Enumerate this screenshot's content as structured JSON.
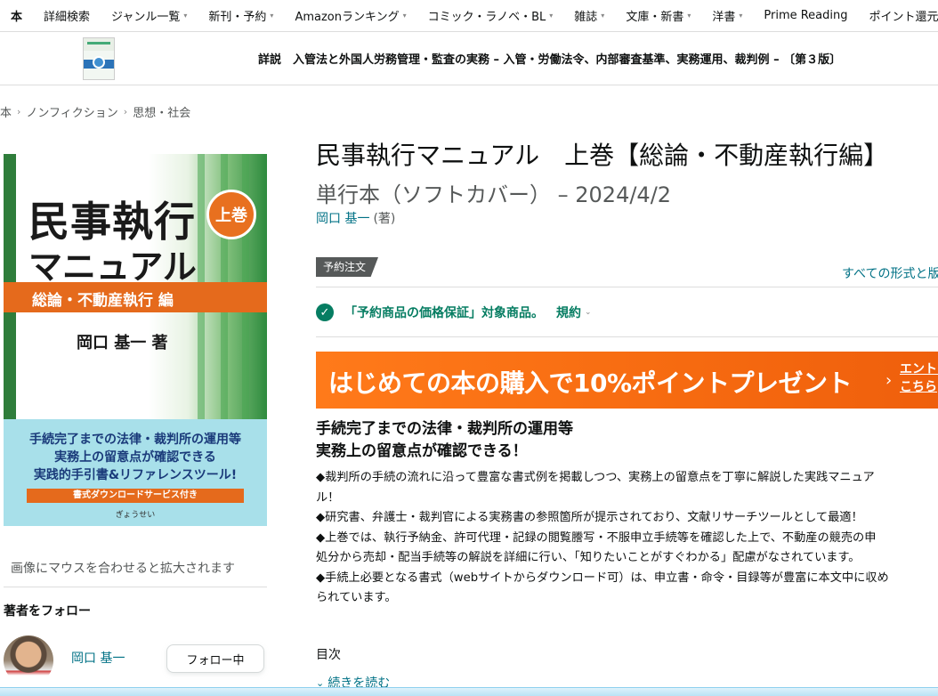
{
  "topnav": {
    "items": [
      {
        "label": "本",
        "caret": false
      },
      {
        "label": "詳細検索",
        "caret": false
      },
      {
        "label": "ジャンル一覧",
        "caret": true
      },
      {
        "label": "新刊・予約",
        "caret": true
      },
      {
        "label": "Amazonランキング",
        "caret": true
      },
      {
        "label": "コミック・ラノベ・BL",
        "caret": true
      },
      {
        "label": "雑誌",
        "caret": true
      },
      {
        "label": "文庫・新書",
        "caret": true
      },
      {
        "label": "洋書",
        "caret": true
      },
      {
        "label": "Prime Reading",
        "caret": false
      },
      {
        "label": "ポイント還元",
        "caret": false
      }
    ]
  },
  "subheader": {
    "title": "詳説　入管法と外国人労務管理・監査の実務 – 入管・労働法令、内部審査基準、実務運用、裁判例 – 〔第３版〕"
  },
  "breadcrumb": [
    "本",
    "ノンフィクション",
    "思想・社会"
  ],
  "cover": {
    "title_line1": "民事執行",
    "title_line2": "マニュアル",
    "volume_badge": "上巻",
    "band": "総論・不動産執行 編",
    "author": "岡口 基一 著",
    "tagline": [
      "手続完了までの法律・裁判所の運用等",
      "実務上の留意点が確認できる",
      "実践的手引書&リファレンスツール!"
    ],
    "download": "書式ダウンロードサービス付き",
    "publisher": "ぎょうせい"
  },
  "left": {
    "zoom_hint": "画像にマウスを合わせると拡大されます",
    "follow_heading": "著者をフォロー",
    "author_name": "岡口 基一",
    "follow_button": "フォロー中"
  },
  "product": {
    "title": "民事執行マニュアル　上巻【総論・不動産執行編】",
    "subtitle": "単行本（ソフトカバー） – 2024/4/2",
    "author": "岡口 基一",
    "role": "(著)",
    "preorder_tag": "予約注文",
    "all_formats": "すべての形式と版",
    "guarantee_text": "「予約商品の価格保証」対象商品。",
    "terms_label": "規約"
  },
  "promo": {
    "text": "はじめての本の購入で10%ポイントプレゼント",
    "entry_line1": "エントリー",
    "entry_line2": "こちら"
  },
  "description": {
    "heading_line1": "手続完了までの法律・裁判所の運用等",
    "heading_line2": "実務上の留意点が確認できる！",
    "lines": [
      "◆裁判所の手続の流れに沿って豊富な書式例を掲載しつつ、実務上の留意点を丁寧に解説した実践マニュア",
      "ル！",
      "◆研究書、弁護士・裁判官による実務書の参照箇所が提示されており、文献リサーチツールとして最適！",
      "◆上巻では、執行予納金、許可代理・記録の閲覧謄写・不服申立手続等を確認した上で、不動産の競売の申",
      "処分から売却・配当手続等の解説を詳細に行い、「知りたいことがすぐわかる」配慮がなされています。",
      "◆手続上必要となる書式（webサイトからダウンロード可）は、申立書・命令・目録等が豊富に本文中に収め",
      "られています。"
    ],
    "toc_label": "目次",
    "read_more": "続きを読む"
  },
  "colors": {
    "link": "#007185",
    "success": "#067d62",
    "promo": "#f66a10",
    "cover_orange": "#e56a1c",
    "cover_green": "#2f7d3b",
    "cover_blue": "#a8e0ea"
  }
}
